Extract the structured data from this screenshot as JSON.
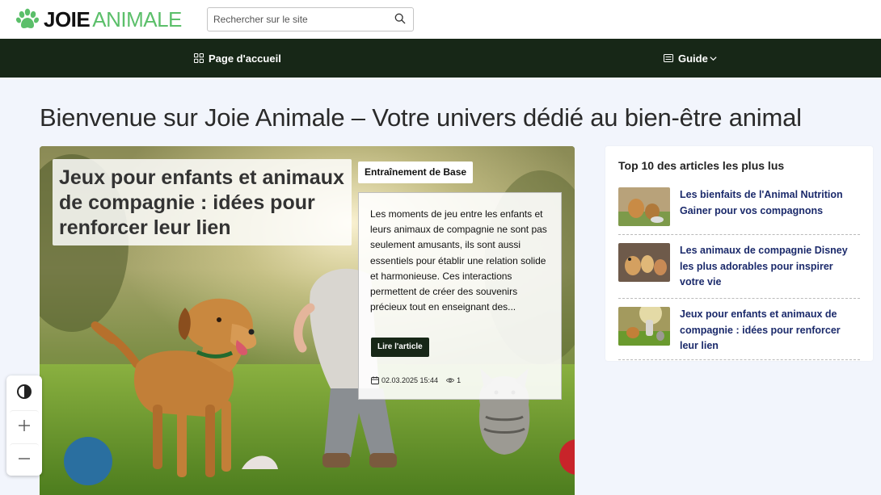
{
  "header": {
    "logo_primary": "JOIE",
    "logo_secondary": "ANIMALE",
    "logo_icon": "paw-icon",
    "search_placeholder": "Rechercher sur le site",
    "search_icon": "search-icon"
  },
  "nav": {
    "items": [
      {
        "label": "Page d'accueil",
        "icon": "grid-icon"
      },
      {
        "label": "Guide",
        "icon": "list-icon",
        "dropdown": true
      }
    ]
  },
  "page": {
    "title": "Bienvenue sur Joie Animale – Votre univers dédié au bien-être animal"
  },
  "hero": {
    "title": "Jeux pour enfants et animaux de compagnie : idées pour renforcer leur lien",
    "category": "Entraînement de Base",
    "excerpt": "Les moments de jeu entre les enfants et leurs animaux de compagnie ne sont pas seulement amusants, ils sont aussi essentiels pour établir une relation solide et harmonieuse. Ces interactions permettent de créer des souvenirs précieux tout en enseignant des...",
    "read_more": "Lire l'article",
    "date": "02.03.2025 15:44",
    "views": "1"
  },
  "sidebar": {
    "title": "Top 10 des articles les plus lus",
    "items": [
      {
        "title": "Les bienfaits de l'Animal Nutrition Gainer pour vos compagnons"
      },
      {
        "title": "Les animaux de compagnie Disney les plus adorables pour inspirer votre vie"
      },
      {
        "title": "Jeux pour enfants et animaux de compagnie : idées pour renforcer leur lien"
      }
    ]
  },
  "accessibility": {
    "buttons": [
      "contrast-icon",
      "zoom-in-icon",
      "zoom-out-icon"
    ]
  },
  "colors": {
    "nav_bg": "#172717",
    "logo_green": "#5bbf6a",
    "link_blue": "#1b2a6b",
    "page_bg": "#f2f5fc"
  }
}
